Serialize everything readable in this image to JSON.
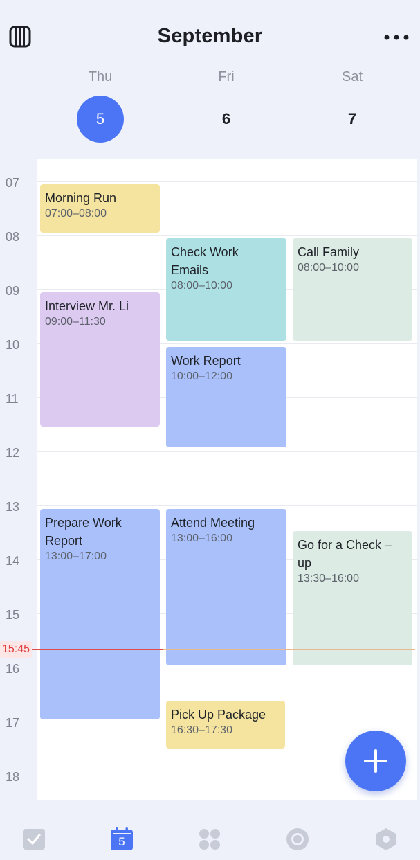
{
  "header": {
    "title": "September",
    "icons": {
      "left": "calendar-view-icon",
      "right": "more-icon"
    }
  },
  "days": [
    {
      "name": "Thu",
      "num": "5",
      "today": true
    },
    {
      "name": "Fri",
      "num": "6",
      "today": false
    },
    {
      "name": "Sat",
      "num": "7",
      "today": false
    }
  ],
  "hours": [
    "07",
    "08",
    "09",
    "10",
    "11",
    "12",
    "13",
    "14",
    "15",
    "16",
    "17",
    "18"
  ],
  "now": {
    "label": "15:45"
  },
  "events": [
    {
      "title": "Morning Run",
      "time": "07:00–08:00",
      "color": "#f5e4a0"
    },
    {
      "title": "Interview Mr. Li",
      "time": "09:00–11:30",
      "color": "#dccaf1"
    },
    {
      "title": "Prepare Work Report",
      "time": "13:00–17:00",
      "color": "#aac0fb"
    },
    {
      "title": "Check Work Emails",
      "time": "08:00–10:00",
      "color": "#ace0e3"
    },
    {
      "title": "Work Report",
      "time": "10:00–12:00",
      "color": "#aac0fb"
    },
    {
      "title": "Attend Meeting",
      "time": "13:00–16:00",
      "color": "#aac0fb"
    },
    {
      "title": "Pick Up Package",
      "time": "16:30–17:30",
      "color": "#f5e4a0"
    },
    {
      "title": "Call Family",
      "time": "08:00–10:00",
      "color": "#dcebe3"
    },
    {
      "title": "Go for a Check –up",
      "time": "13:30–16:00",
      "color": "#dcebe3"
    }
  ],
  "fab": {
    "icon": "plus-icon"
  },
  "tabbar": {
    "items": [
      {
        "icon": "tasks-check-icon"
      },
      {
        "icon": "calendar-icon",
        "label": "5",
        "active": true
      },
      {
        "icon": "apps-grid-icon"
      },
      {
        "icon": "focus-circle-icon"
      },
      {
        "icon": "hexagon-settings-icon"
      }
    ]
  },
  "colors": {
    "accent": "#4c75f5",
    "now_line": "#e24a4a"
  }
}
